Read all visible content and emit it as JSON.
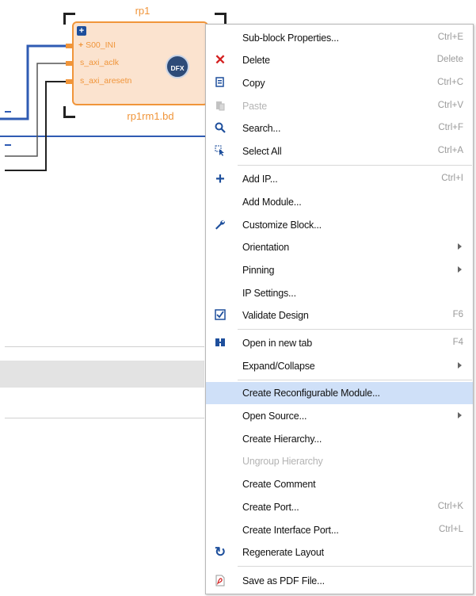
{
  "diagram": {
    "block_title": "rp1",
    "block_file": "rp1rm1.bd",
    "ports": [
      "S00_INI",
      "s_axi_aclk",
      "s_axi_aresetn"
    ],
    "dfx_badge": "DFX"
  },
  "context_menu": {
    "items": [
      {
        "label": "Sub-block Properties...",
        "shortcut": "Ctrl+E",
        "icon": "none"
      },
      {
        "label": "Delete",
        "shortcut": "Delete",
        "icon": "delete-x-icon"
      },
      {
        "label": "Copy",
        "shortcut": "Ctrl+C",
        "icon": "copy-icon"
      },
      {
        "label": "Paste",
        "shortcut": "Ctrl+V",
        "icon": "paste-icon",
        "disabled": true
      },
      {
        "label": "Search...",
        "shortcut": "Ctrl+F",
        "icon": "search-icon"
      },
      {
        "label": "Select All",
        "shortcut": "Ctrl+A",
        "icon": "select-all-icon"
      },
      {
        "label": "Add IP...",
        "shortcut": "Ctrl+I",
        "icon": "add-icon"
      },
      {
        "label": "Add Module...",
        "shortcut": "",
        "icon": "none"
      },
      {
        "label": "Customize Block...",
        "shortcut": "",
        "icon": "wrench-icon"
      },
      {
        "label": "Orientation",
        "shortcut": "",
        "icon": "none",
        "submenu": true
      },
      {
        "label": "Pinning",
        "shortcut": "",
        "icon": "none",
        "submenu": true
      },
      {
        "label": "IP Settings...",
        "shortcut": "",
        "icon": "none"
      },
      {
        "label": "Validate Design",
        "shortcut": "F6",
        "icon": "validate-icon"
      },
      {
        "label": "Open in new tab",
        "shortcut": "F4",
        "icon": "open-tab-icon"
      },
      {
        "label": "Expand/Collapse",
        "shortcut": "",
        "icon": "none",
        "submenu": true
      },
      {
        "label": "Create Reconfigurable Module...",
        "shortcut": "",
        "icon": "none",
        "highlighted": true
      },
      {
        "label": "Open Source...",
        "shortcut": "",
        "icon": "none",
        "submenu": true
      },
      {
        "label": "Create Hierarchy...",
        "shortcut": "",
        "icon": "none"
      },
      {
        "label": "Ungroup Hierarchy",
        "shortcut": "",
        "icon": "none",
        "disabled": true
      },
      {
        "label": "Create Comment",
        "shortcut": "",
        "icon": "none"
      },
      {
        "label": "Create Port...",
        "shortcut": "Ctrl+K",
        "icon": "none"
      },
      {
        "label": "Create Interface Port...",
        "shortcut": "Ctrl+L",
        "icon": "none"
      },
      {
        "label": "Regenerate Layout",
        "shortcut": "",
        "icon": "regenerate-icon"
      },
      {
        "label": "Save as PDF File...",
        "shortcut": "",
        "icon": "pdf-icon"
      }
    ]
  },
  "colors": {
    "block_orange": "#f0953a",
    "block_fill": "#fbe3cf",
    "wire_blue": "#2f5bb3",
    "highlight": "#cfe0f8"
  }
}
